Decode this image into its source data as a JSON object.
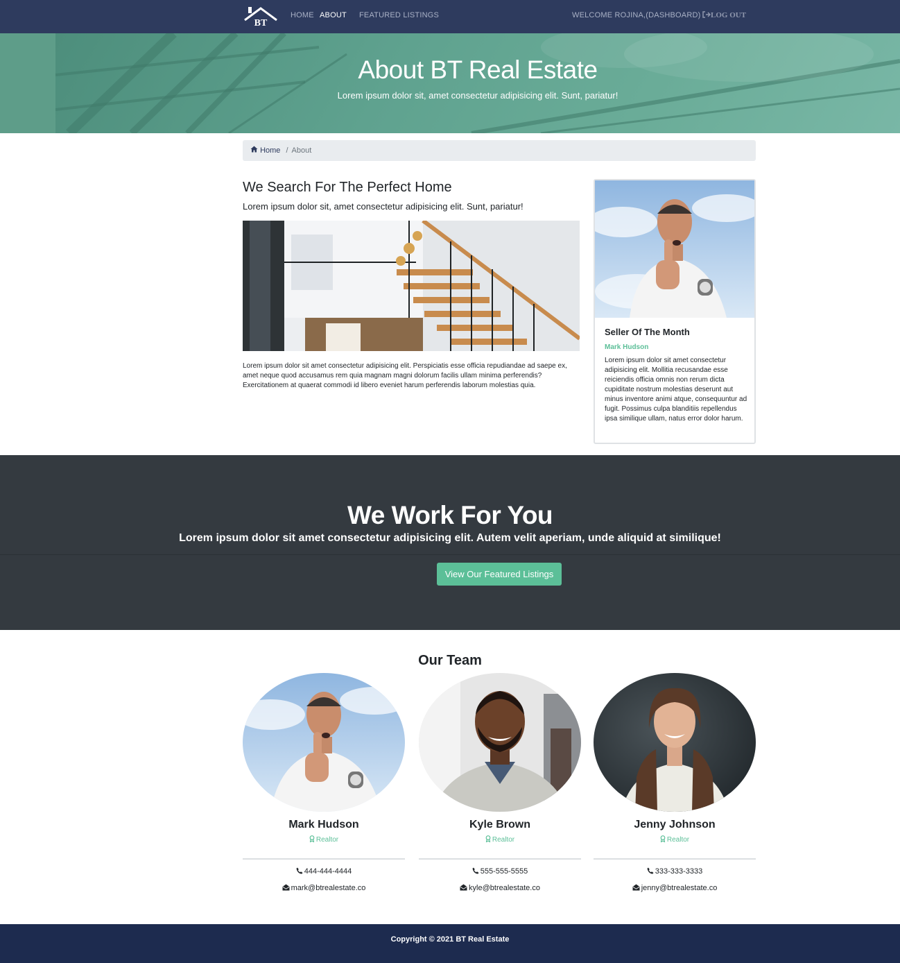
{
  "nav": {
    "brand_text": "BT",
    "links": [
      {
        "label": "HOME",
        "active": false
      },
      {
        "label": "ABOUT",
        "active": true
      },
      {
        "label": "FEATURED LISTINGS",
        "active": false
      }
    ],
    "welcome": "WELCOME ROJINA,(DASHBOARD)",
    "logout": "LOG OUT"
  },
  "hero": {
    "title": "About BT Real Estate",
    "subtitle": "Lorem ipsum dolor sit, amet consectetur adipisicing elit. Sunt, pariatur!"
  },
  "breadcrumb": {
    "home": "Home",
    "separator": "/",
    "current": "About"
  },
  "about": {
    "heading": "We Search For The Perfect Home",
    "lead": "Lorem ipsum dolor sit, amet consectetur adipisicing elit. Sunt, pariatur!",
    "body": "Lorem ipsum dolor sit amet consectetur adipisicing elit. Perspiciatis esse officia repudiandae ad saepe ex, amet neque quod accusamus rem quia magnam magni dolorum facilis ullam minima perferendis? Exercitationem at quaerat commodi id libero eveniet harum perferendis laborum molestias quia."
  },
  "seller": {
    "title": "Seller Of The Month",
    "name": "Mark Hudson",
    "description": "Lorem ipsum dolor sit amet consectetur adipisicing elit. Mollitia recusandae esse reiciendis officia omnis non rerum dicta cupiditate nostrum molestias deserunt aut minus inventore animi atque, consequuntur ad fugit. Possimus culpa blanditiis repellendus ipsa similique ullam, natus error dolor harum."
  },
  "work": {
    "title": "We Work For You",
    "subtitle": "Lorem ipsum dolor sit amet consectetur adipisicing elit. Autem velit aperiam, unde aliquid at similique!",
    "button": "View Our Featured Listings"
  },
  "team": {
    "title": "Our Team",
    "members": [
      {
        "name": "Mark Hudson",
        "role": "Realtor",
        "phone": "444-444-4444",
        "email": "mark@btrealestate.co"
      },
      {
        "name": "Kyle Brown",
        "role": "Realtor",
        "phone": "555-555-5555",
        "email": "kyle@btrealestate.co"
      },
      {
        "name": "Jenny Johnson",
        "role": "Realtor",
        "phone": "333-333-3333",
        "email": "jenny@btrealestate.co"
      }
    ]
  },
  "footer": {
    "copyright": "Copyright © 2021 BT Real Estate"
  },
  "colors": {
    "navbar": "#2e3b5e",
    "accent": "#5cbf98",
    "dark_section": "#343a40",
    "footer": "#1d2b4f"
  },
  "icons": [
    "logo-house-icon",
    "logout-icon",
    "home-icon",
    "award-icon",
    "phone-icon",
    "envelope-icon"
  ]
}
